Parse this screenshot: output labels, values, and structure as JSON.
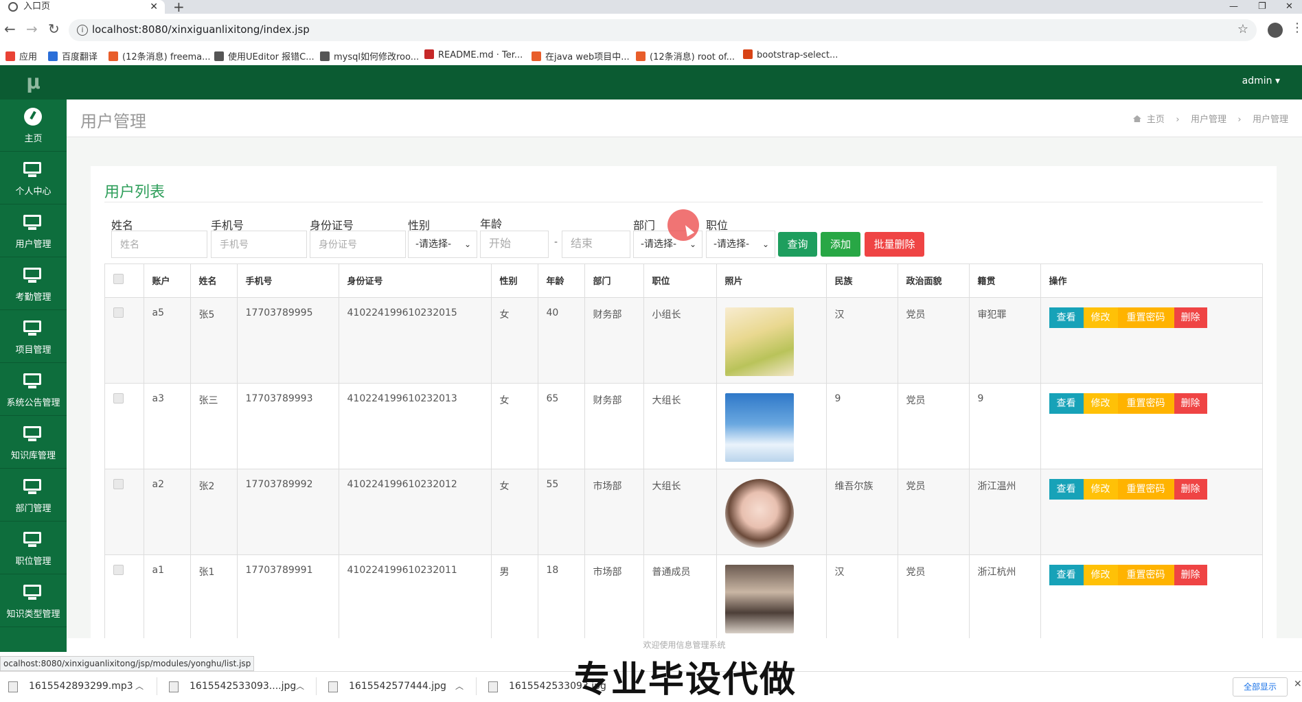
{
  "browser": {
    "tab_title": "入口页",
    "url": "localhost:8080/xinxiguanlixitong/index.jsp",
    "bookmarks": [
      {
        "label": "应用",
        "color": "#e94235"
      },
      {
        "label": "百度翻译",
        "color": "#2a6ed8"
      },
      {
        "label": "(12条消息) freema...",
        "color": "#e85d2a"
      },
      {
        "label": "使用UEditor 报错C...",
        "color": "#555555"
      },
      {
        "label": "mysql如何修改roo...",
        "color": "#555555"
      },
      {
        "label": "README.md · Ter...",
        "color": "#c62828"
      },
      {
        "label": "在java web项目中...",
        "color": "#e85d2a"
      },
      {
        "label": "(12条消息) root of...",
        "color": "#e85d2a"
      },
      {
        "label": "bootstrap-select...",
        "color": "#d84315"
      }
    ],
    "status_url": "ocalhost:8080/xinxiguanlixitong/jsp/modules/yonghu/list.jsp"
  },
  "sidebar": {
    "logo": "μ",
    "items": [
      {
        "label": "主页",
        "icon": "dashboard-icon"
      },
      {
        "label": "个人中心",
        "icon": "monitor-icon"
      },
      {
        "label": "用户管理",
        "icon": "monitor-icon"
      },
      {
        "label": "考勤管理",
        "icon": "monitor-icon"
      },
      {
        "label": "项目管理",
        "icon": "monitor-icon"
      },
      {
        "label": "系统公告管理",
        "icon": "monitor-icon"
      },
      {
        "label": "知识库管理",
        "icon": "monitor-icon"
      },
      {
        "label": "部门管理",
        "icon": "monitor-icon"
      },
      {
        "label": "职位管理",
        "icon": "monitor-icon"
      },
      {
        "label": "知识类型管理",
        "icon": "monitor-icon"
      }
    ]
  },
  "topnav": {
    "user": "admin ▾"
  },
  "page": {
    "title": "用户管理",
    "breadcrumbs": [
      "主页",
      "用户管理",
      "用户管理"
    ],
    "panel_title": "用户列表"
  },
  "filters": {
    "name_label": "姓名",
    "name_placeholder": "姓名",
    "phone_label": "手机号",
    "phone_placeholder": "手机号",
    "id_label": "身份证号",
    "id_placeholder": "身份证号",
    "gender_label": "性别",
    "gender_value": "-请选择-",
    "age_label": "年龄",
    "age_start": "开始",
    "age_end": "结束",
    "age_sep": "-",
    "dept_label": "部门",
    "dept_value": "-请选择-",
    "job_label": "职位",
    "job_value": "-请选择-",
    "query_btn": "查询",
    "add_btn": "添加",
    "batch_delete_btn": "批量删除"
  },
  "table": {
    "headers": [
      "账户",
      "姓名",
      "手机号",
      "身份证号",
      "性别",
      "年龄",
      "部门",
      "职位",
      "照片",
      "民族",
      "政治面貌",
      "籍贯",
      "操作"
    ],
    "actions": {
      "view": "查看",
      "edit": "修改",
      "reset": "重置密码",
      "delete": "删除"
    },
    "rows": [
      {
        "account": "a5",
        "name": "张5",
        "phone": "17703789995",
        "id_no": "410224199610232015",
        "gender": "女",
        "age": "40",
        "dept": "财务部",
        "job": "小组长",
        "photo": "anime-girl-photo",
        "nation": "汉",
        "politics": "党员",
        "origin": "审犯罪"
      },
      {
        "account": "a3",
        "name": "张三",
        "phone": "17703789993",
        "id_no": "410224199610232013",
        "gender": "女",
        "age": "65",
        "dept": "财务部",
        "job": "大组长",
        "photo": "sky-boy-photo",
        "nation": "9",
        "politics": "党员",
        "origin": "9"
      },
      {
        "account": "a2",
        "name": "张2",
        "phone": "17703789992",
        "id_no": "410224199610232012",
        "gender": "女",
        "age": "55",
        "dept": "市场部",
        "job": "大组长",
        "photo": "portrait-girl-photo",
        "nation": "维吾尔族",
        "politics": "党员",
        "origin": "浙江温州"
      },
      {
        "account": "a1",
        "name": "张1",
        "phone": "17703789991",
        "id_no": "410224199610232011",
        "gender": "男",
        "age": "18",
        "dept": "市场部",
        "job": "普通成员",
        "photo": "mirror-selfie-photo",
        "nation": "汉",
        "politics": "党员",
        "origin": "浙江杭州"
      }
    ]
  },
  "footer": {
    "text": "欢迎使用信息管理系统"
  },
  "downloads": {
    "items": [
      "1615542893299.mp3",
      "1615542533093....jpg",
      "1615542577444.jpg",
      "1615542533093.jpg"
    ],
    "show_all": "全部显示"
  },
  "overlay_caption": "专业毕设代做",
  "colors": {
    "sidebar": "#0e6e3d",
    "topnav": "#0b5b32",
    "accent_title": "#2e9e5a",
    "query": "#1e9e5e",
    "add": "#28a745",
    "batch_delete": "#ef4444",
    "view": "#17a2b8",
    "edit": "#ffc107",
    "reset": "#ffb300",
    "delete": "#ef4444"
  }
}
